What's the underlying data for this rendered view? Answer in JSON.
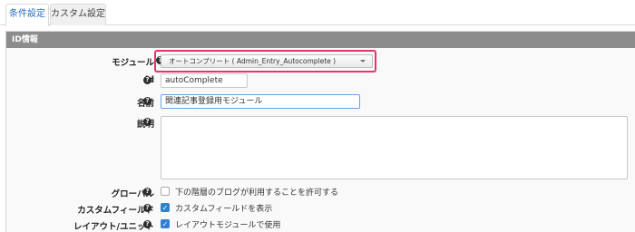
{
  "tabs": [
    {
      "label": "条件設定",
      "active": true
    },
    {
      "label": "カスタム設定",
      "active": false
    }
  ],
  "panel": {
    "title": "ID情報"
  },
  "help_icon_glyph": "?",
  "fields": {
    "module": {
      "label": "モジュール",
      "value": "オートコンプリート ( Admin_Entry_Autocomplete )"
    },
    "id": {
      "label": "id",
      "value": "autoComplete"
    },
    "name": {
      "label": "名前",
      "value": "関連記事登録用モジュール"
    },
    "description": {
      "label": "説明",
      "value": ""
    },
    "global": {
      "label": "グローバル",
      "checkbox_text": "下の階層のブログが利用することを許可する",
      "checked": false
    },
    "custom_field": {
      "label": "カスタムフィールド",
      "checkbox_text": "カスタムフィールドを表示",
      "checked": true
    },
    "layout_unit": {
      "label": "レイアウト/ユニット",
      "checkbox_text": "レイアウトモジュールで使用",
      "checked": true
    }
  },
  "colors": {
    "accent": "#2a6fba",
    "highlight": "#e3356f",
    "checkbox_on": "#2f7fd3",
    "panel_header": "#8c8c8c"
  }
}
